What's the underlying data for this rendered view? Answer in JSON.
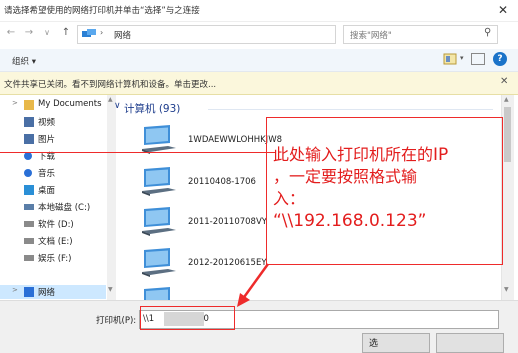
{
  "window": {
    "title": "请选择希望使用的网络打印机并单击“选择”与之连接",
    "close_glyph": "✕"
  },
  "address_bar": {
    "back_glyph": "←",
    "forward_glyph": "→",
    "dropdown_glyph": "∨",
    "up_glyph": "↑",
    "path_chevron": "›",
    "path": "网络",
    "addr_dropdown_glyph": "∨",
    "refresh_glyph": "↻",
    "search_placeholder": "搜索\"网络\"",
    "search_glyph": "⚲"
  },
  "toolbar": {
    "organize_label": "组织 ▾",
    "view_dropdown_glyph": "▾",
    "help_glyph": "?"
  },
  "info_bar": {
    "text": "文件共享已关闭。看不到网络计算机和设备。单击更改...",
    "close_glyph": "✕"
  },
  "nav": {
    "expand_glyph": ">",
    "items": [
      {
        "label": "My Documents",
        "icon": "folder-icon",
        "color": "#e8b84a",
        "expand": true
      },
      {
        "label": "视频",
        "icon": "video-icon",
        "color": "#4a6fa5"
      },
      {
        "label": "图片",
        "icon": "pictures-icon",
        "color": "#4a6fa5"
      },
      {
        "label": "下载",
        "icon": "download-icon",
        "color": "#2a6fd6"
      },
      {
        "label": "音乐",
        "icon": "music-icon",
        "color": "#2a6fd6"
      },
      {
        "label": "桌面",
        "icon": "desktop-icon",
        "color": "#2a8fd6"
      },
      {
        "label": "本地磁盘 (C:)",
        "icon": "drive-icon",
        "color": "#5a7ea8"
      },
      {
        "label": "软件 (D:)",
        "icon": "drive-icon",
        "color": "#8a8a8a"
      },
      {
        "label": "文档 (E:)",
        "icon": "drive-icon",
        "color": "#8a8a8a"
      },
      {
        "label": "娱乐 (F:)",
        "icon": "drive-icon",
        "color": "#8a8a8a"
      },
      {
        "label": "网络",
        "icon": "network-icon",
        "color": "#2a6fd6",
        "expand": true
      }
    ],
    "scroll_up_glyph": "▲",
    "scroll_down_glyph": "▼"
  },
  "content": {
    "group_chevron": "∨",
    "group_header": "计算机 (93)",
    "computers": [
      {
        "name": "1WDAEWWLOHHKJW8"
      },
      {
        "name": "20110408-1706"
      },
      {
        "name": "2011-20110708VY"
      },
      {
        "name": "2012-20120615EY"
      },
      {
        "name": ""
      }
    ],
    "scroll_up_glyph": "▲",
    "scroll_down_glyph": "▼"
  },
  "bottom": {
    "printer_label": "打印机(P):",
    "printer_value_start": "\\\\1",
    "printer_value_end": "70",
    "select_label": "选"
  },
  "annotation": {
    "line1": "此处输入打印机所在的",
    "line1_end": "IP",
    "line2": "，一定要按照格式输",
    "line3": "入：",
    "line4": "“\\\\192.168.0.123”",
    "color": "#e31d1d"
  }
}
